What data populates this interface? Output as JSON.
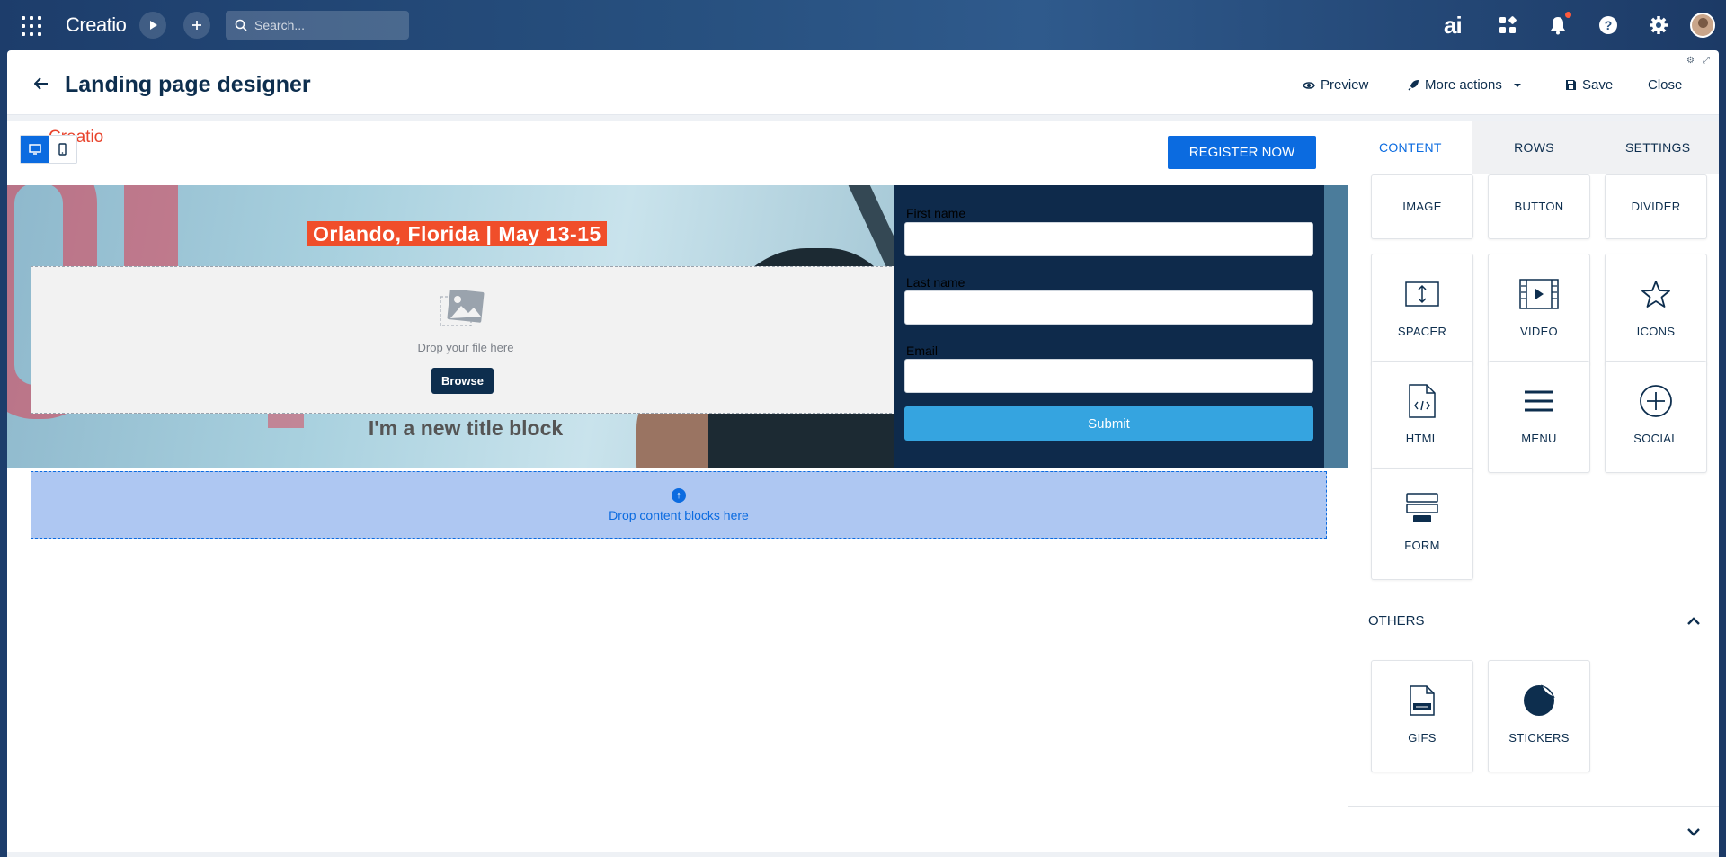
{
  "topbar": {
    "logo": "Creatio",
    "search_placeholder": "Search...",
    "ai_label": "ai"
  },
  "header": {
    "title": "Landing page designer",
    "preview_label": "Preview",
    "more_actions_label": "More actions",
    "save_label": "Save",
    "close_label": "Close"
  },
  "canvas": {
    "logo_text": "Creatio",
    "register_label": "REGISTER NOW",
    "date_banner": "Orlando, Florida | May 13-15",
    "drop_file_text": "Drop your file here",
    "browse_label": "Browse",
    "title_block": "I'm a new title block",
    "form": {
      "first_name_label": "First name",
      "last_name_label": "Last name",
      "email_label": "Email",
      "submit_label": "Submit"
    },
    "drop_blocks_text": "Drop content blocks here"
  },
  "panel": {
    "tabs": [
      "CONTENT",
      "ROWS",
      "SETTINGS"
    ],
    "content_tiles": [
      "IMAGE",
      "BUTTON",
      "DIVIDER",
      "SPACER",
      "VIDEO",
      "ICONS",
      "HTML",
      "MENU",
      "SOCIAL",
      "FORM"
    ],
    "others_title": "OTHERS",
    "others_tiles": [
      "GIFS",
      "STICKERS"
    ]
  },
  "colors": {
    "primary": "#0b6be0",
    "navy": "#0d2e4e",
    "banner": "#f04e2a",
    "submit": "#35a4e0",
    "drop_zone": "#aec7f2"
  }
}
